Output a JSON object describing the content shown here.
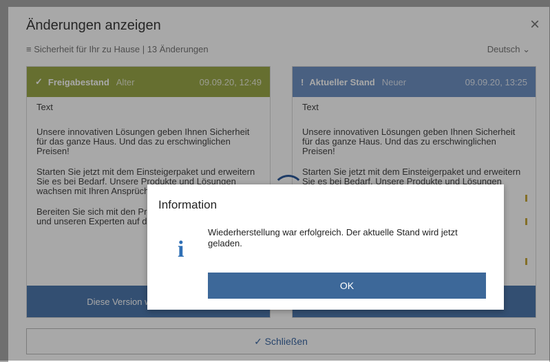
{
  "dialog": {
    "title": "Änderungen anzeigen",
    "close_icon": "×",
    "breadcrumb": "≡ Sicherheit für Ihr zu Hause  |  13 Änderungen",
    "language": "Deutsch ⌄",
    "close_label": "✓  Schließen"
  },
  "left_panel": {
    "mark": "✓",
    "title": "Freigabestand",
    "age": "Alter",
    "date": "09.09.20, 12:49",
    "label": "Text",
    "paragraphs": [
      "Unsere innovativen Lösungen geben Ihnen Sicherheit für das ganze Haus. Und das zu erschwinglichen Preisen!",
      "Starten Sie jetzt mit dem Einsteigerpaket und erweitern Sie es bei Bedarf. Unsere Produkte und Lösungen wachsen mit Ihren Ansprüchen.",
      "Bereiten Sie sich mit den Produkten von Smart Living und unseren Experten auf das Unerwartete vor."
    ],
    "footer": "Diese Version wiederherstellen"
  },
  "right_panel": {
    "mark": "!",
    "title": "Aktueller Stand",
    "age": "Neuer",
    "date": "09.09.20, 13:25",
    "label": "Text",
    "paragraphs": [
      "Unsere innovativen Lösungen geben Ihnen Sicherheit für das ganze Haus. Und das zu erschwinglichen Preisen!",
      "Starten Sie jetzt mit dem Einsteigerpaket und erweitern Sie es bei Bedarf. Unsere Produkte und Lösungen wachsen mit Ihren Ansprüchen, wieder",
      ""
    ],
    "footer": ""
  },
  "message": {
    "title": "Information",
    "icon": "i",
    "text": "Wiederherstellung war erfolgreich. Der aktuelle Stand wird jetzt geladen.",
    "ok": "OK"
  }
}
